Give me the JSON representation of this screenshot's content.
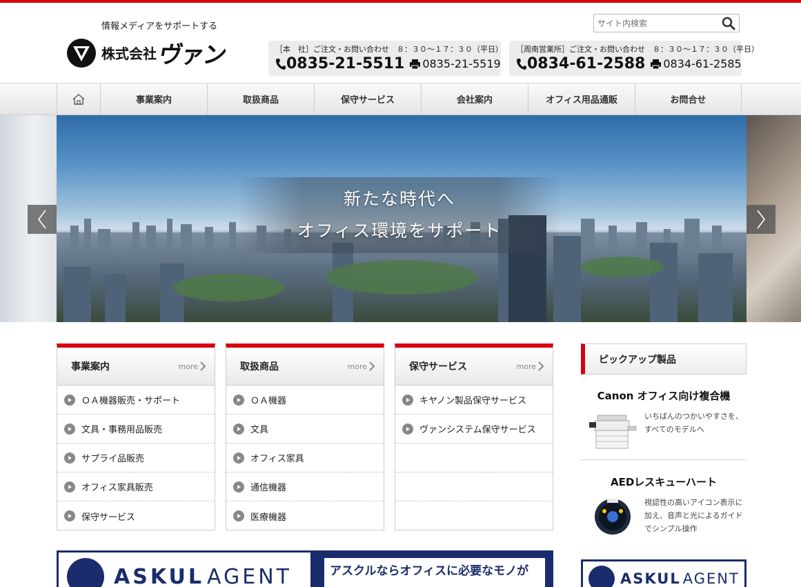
{
  "header": {
    "tagline": "情報メディアをサポートする",
    "logo_small": "株式会社",
    "logo_big": "ヴァン",
    "search_placeholder": "サイト内検索",
    "offices": [
      {
        "label": "［本　社］ご注文・お問い合わせ　８：３０～１７：３０（平日）",
        "tel": "0835-21-5511",
        "fax": "0835-21-5519"
      },
      {
        "label": "［周南営業所］ご注文・お問い合わせ　８：３０～１７：３０（平日）",
        "tel": "0834-61-2588",
        "fax": "0834-61-2585"
      }
    ]
  },
  "nav": {
    "items": [
      "事業案内",
      "取扱商品",
      "保守サービス",
      "会社案内",
      "オフィス用品通販",
      "お問合せ"
    ]
  },
  "hero": {
    "line1": "新たな時代へ",
    "line2": "オフィス環境をサポート"
  },
  "cards": [
    {
      "title": "事業案内",
      "more": "more",
      "items": [
        "ＯＡ機器販売・サポート",
        "文具・事務用品販売",
        "サプライ品販売",
        "オフィス家具販売",
        "保守サービス"
      ]
    },
    {
      "title": "取扱商品",
      "more": "more",
      "items": [
        "ＯＡ機器",
        "文具",
        "オフィス家具",
        "通信機器",
        "医療機器"
      ]
    },
    {
      "title": "保守サービス",
      "more": "more",
      "items": [
        "キヤノン製品保守サービス",
        "ヴァンシステム保守サービス"
      ]
    }
  ],
  "pickup": {
    "title": "ピックアップ製品",
    "products": [
      {
        "title": "Canon オフィス向け複合機",
        "desc": "いちばんのつかいやすさを、すべてのモデルへ"
      },
      {
        "title": "AEDレスキューハート",
        "desc": "視認性の高いアイコン表示に加え、音声と光によるガイドでシンプル操作"
      }
    ]
  },
  "banners": {
    "askul_word": "ASKUL",
    "askul_agent": "AGENT",
    "askul_copy": "アスクルならオフィスに必要なモノが"
  },
  "colors": {
    "accent": "#d7000f",
    "navy": "#1a2c6b"
  }
}
